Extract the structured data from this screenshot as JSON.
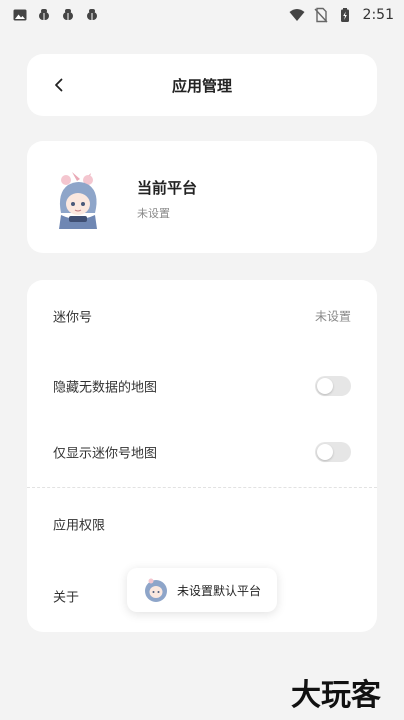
{
  "status_bar": {
    "time": "2:51",
    "left_icons": [
      "image-icon",
      "bug-icon",
      "bug-icon",
      "bug-icon"
    ],
    "right_icons": [
      "wifi-icon",
      "no-sim-icon",
      "battery-icon"
    ]
  },
  "header": {
    "title": "应用管理",
    "back_icon": "chevron-left-icon"
  },
  "platform": {
    "title": "当前平台",
    "subtitle": "未设置"
  },
  "settings": {
    "mini_id": {
      "label": "迷你号",
      "value": "未设置"
    },
    "hide_no_data_maps": {
      "label": "隐藏无数据的地图",
      "enabled": false
    },
    "only_mini_maps": {
      "label": "仅显示迷你号地图",
      "enabled": false
    },
    "app_permissions": {
      "label": "应用权限"
    },
    "about": {
      "label": "关于"
    }
  },
  "toast": {
    "text": "未设置默认平台"
  },
  "watermark": {
    "text": "大玩客"
  },
  "colors": {
    "background": "#f3f3f3",
    "card": "#ffffff",
    "toggle_off": "#e6e6e6",
    "text_primary": "#222222",
    "text_secondary": "#888888"
  }
}
